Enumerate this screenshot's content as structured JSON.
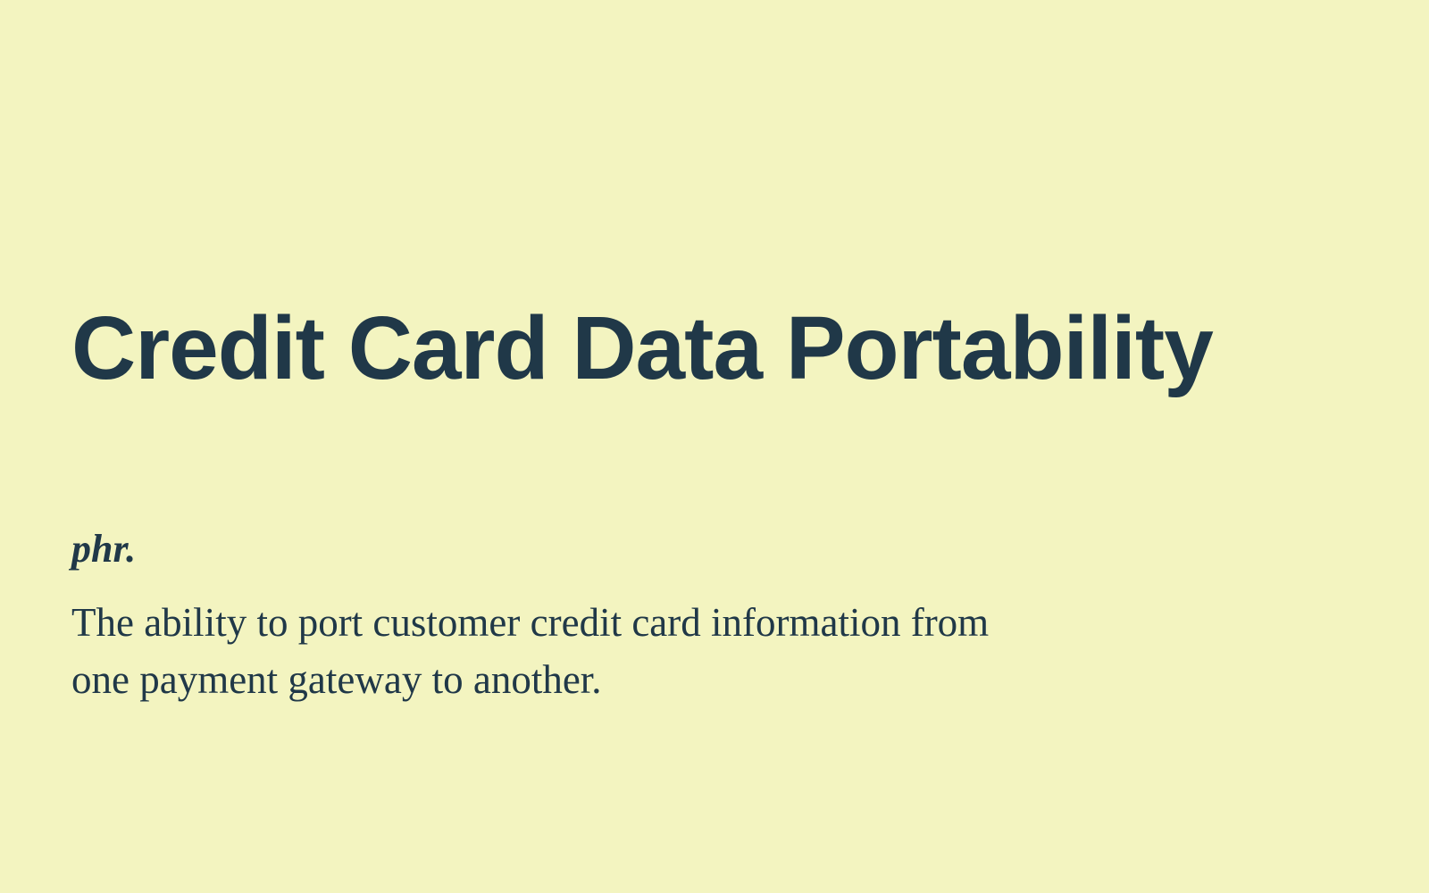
{
  "slide": {
    "title": "Credit Card Data Portability",
    "part_of_speech": "phr.",
    "definition": "The ability to port customer credit card information from one payment gateway to another."
  },
  "colors": {
    "background": "#f3f4c0",
    "text": "#203848"
  }
}
